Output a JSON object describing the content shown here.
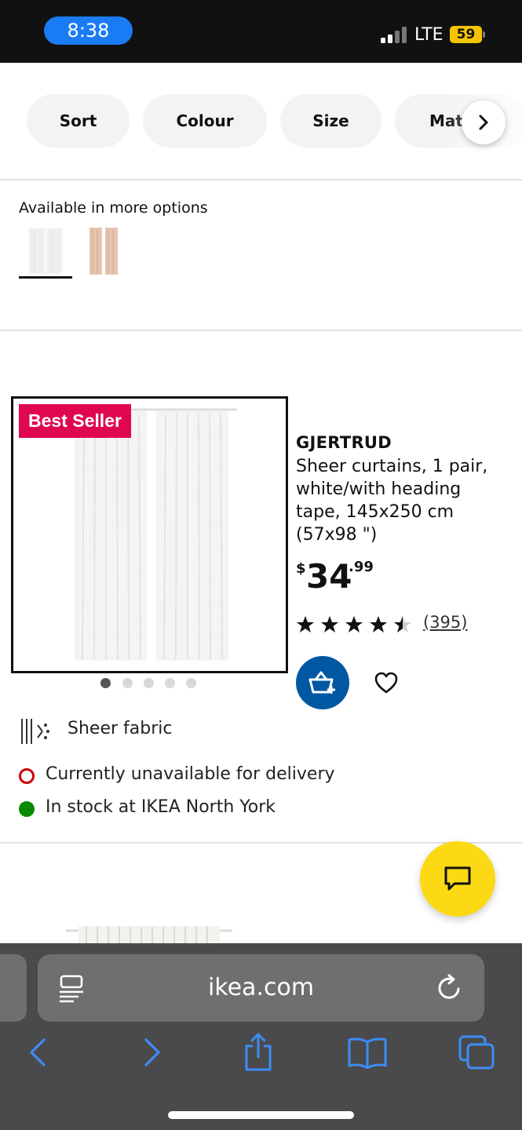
{
  "status_bar": {
    "time": "8:38",
    "network": "LTE",
    "battery": "59"
  },
  "filters": [
    {
      "label": "Sort"
    },
    {
      "label": "Colour"
    },
    {
      "label": "Size"
    },
    {
      "label": "Mat"
    }
  ],
  "options": {
    "label": "Available in more options"
  },
  "product": {
    "badge": "Best Seller",
    "brand": "GJERTRUD",
    "description": "Sheer curtains, 1 pair, white/with heading tape, 145x250 cm (57x98 \")",
    "price": {
      "currency": "$",
      "integer": "34",
      "decimals": ".99"
    },
    "rating": 4.5,
    "reviews": "(395)",
    "feature": "Sheer fabric",
    "delivery": "Currently unavailable for delivery",
    "stock": "In stock at IKEA North York",
    "image_dots": 5,
    "active_dot": 1
  },
  "browser": {
    "url": "ikea.com"
  },
  "colors": {
    "ikea_blue": "#0058a3",
    "badge_red": "#e00751",
    "chat_yellow": "#fbd914",
    "stock_green": "#0a8a00",
    "unavailable_red": "#cc0008"
  }
}
